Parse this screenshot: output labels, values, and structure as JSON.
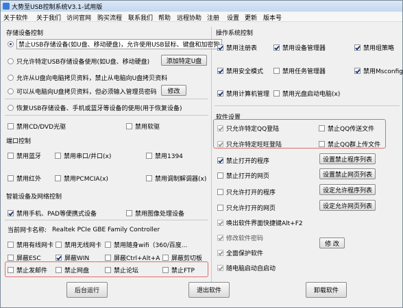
{
  "window": {
    "title": "大势至USB控制系统V3.1-试用版"
  },
  "menu": [
    "关于软件",
    "关于我们",
    "访问官网",
    "购买流程",
    "联系我们",
    "帮助",
    "远程协助",
    "注册",
    "设置",
    "更新",
    "版本号"
  ],
  "storage": {
    "title": "存储设备控制",
    "radios": [
      {
        "label": "禁止USB存储设备(如U盘、移动硬盘)，允许使用USB鼠标、键盘和加密狗",
        "selected": true
      },
      {
        "label": "只允许特定USB存储设备使用(如U盘、移动硬盘)",
        "selected": false
      },
      {
        "label": "允许从U盘向电脑拷贝资料，禁止从电脑向U盘拷贝资料",
        "selected": false
      },
      {
        "label": "可以从电脑向U盘拷贝资料，但必须输入管理员密码",
        "selected": false
      },
      {
        "label": "恢复USB存储设备、手机或蓝牙等设备的使用(用于恢复设备)",
        "selected": false
      }
    ],
    "add_udisk_button": "添加特定U盘",
    "modify_button": "修改"
  },
  "cd": [
    {
      "label": "禁用CD/DVD光驱",
      "checked": false
    },
    {
      "label": "禁用软驱",
      "checked": false
    }
  ],
  "ports": {
    "title": "端口控制",
    "items": [
      {
        "label": "禁用蓝牙",
        "checked": false
      },
      {
        "label": "禁用串口/并口(x)",
        "checked": false
      },
      {
        "label": "禁用1394",
        "checked": false
      },
      {
        "label": "禁用红外",
        "checked": false
      },
      {
        "label": "禁用PCMCIA(x)",
        "checked": false
      },
      {
        "label": "禁用调制解调器(x)",
        "checked": false
      }
    ]
  },
  "smart": {
    "title": "智能设备及网络控制",
    "items": [
      {
        "label": "禁用手机、PAD等便携式设备",
        "checked": true
      },
      {
        "label": "禁用图像处理设备",
        "checked": false
      }
    ]
  },
  "nic": {
    "label": "当前网卡名称:",
    "value": "Realtek PCIe GBE Family Controller",
    "items": [
      {
        "label": "禁用有线网卡",
        "checked": false
      },
      {
        "label": "禁用无线网卡",
        "checked": false
      },
      {
        "label": "禁用随身wifi（360/百度...",
        "checked": false
      },
      {
        "label": "屏蔽ESC",
        "checked": false
      },
      {
        "label": "屏蔽WIN",
        "checked": true
      },
      {
        "label": "屏蔽Ctrl+Alt+A",
        "checked": false
      },
      {
        "label": "屏蔽剪切板",
        "checked": false
      }
    ],
    "highlighted": [
      {
        "label": "禁止发邮件",
        "checked": false
      },
      {
        "label": "禁止网盘",
        "checked": false
      },
      {
        "label": "禁止论坛",
        "checked": false
      },
      {
        "label": "禁止FTP",
        "checked": false
      }
    ]
  },
  "os": {
    "title": "操作系统控制",
    "items": [
      {
        "label": "禁用注册表",
        "checked": true
      },
      {
        "label": "禁用设备管理器",
        "checked": true
      },
      {
        "label": "禁用组策略",
        "checked": true
      },
      {
        "label": "禁用安全模式",
        "checked": true
      },
      {
        "label": "禁用任务管理器",
        "checked": false
      },
      {
        "label": "禁用Msconfig",
        "checked": true
      },
      {
        "label": "禁用计算机管理",
        "checked": true
      },
      {
        "label": "禁用光盘启动电脑(x)",
        "checked": false
      }
    ]
  },
  "software": {
    "title": "软件设置",
    "highlighted": [
      {
        "label": "只允许特定QQ登陆",
        "checked": true
      },
      {
        "label": "禁止QQ传送文件",
        "checked": false
      },
      {
        "label": "只允许特定旺旺登陆",
        "checked": true
      },
      {
        "label": "禁止QQ群上传文件",
        "checked": false
      }
    ],
    "list_items": [
      {
        "label": "禁止打开的程序",
        "checked": true,
        "button": "设置禁止程序列表"
      },
      {
        "label": "禁止打开的网页",
        "checked": false,
        "button": "设置禁止网页列表"
      },
      {
        "label": "只允许打开的程序",
        "checked": false,
        "button": "设定允许程序列表"
      },
      {
        "label": "只允许打开的网页",
        "checked": false,
        "button": "设定允许网页列表"
      }
    ],
    "extra": [
      {
        "label": "唤出软件界面快捷键Alt+F2",
        "checked": true
      },
      {
        "label": "修改软件密码",
        "checked": true
      },
      {
        "label": "全面保护软件",
        "checked": true
      },
      {
        "label": "随电脑启动自启动",
        "checked": true
      }
    ],
    "modify_button": "修 改"
  },
  "footer": {
    "background_run": "后台运行",
    "exit": "退出软件",
    "uninstall": "卸载软件"
  },
  "colors": {
    "highlight_border": "#e06c6c",
    "titlebar": "#c4d8ee"
  }
}
